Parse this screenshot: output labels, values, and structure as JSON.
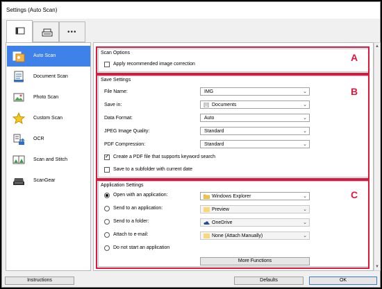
{
  "window": {
    "title": "Settings (Auto Scan)"
  },
  "top_tabs": [
    {
      "icon": "scan-from-computer-icon"
    },
    {
      "icon": "scan-from-operation-panel-icon"
    },
    {
      "icon": "more-icon",
      "label": "•••"
    }
  ],
  "sidebar": {
    "items": [
      {
        "label": "Auto Scan",
        "icon": "auto-scan-icon",
        "selected": true
      },
      {
        "label": "Document Scan",
        "icon": "document-scan-icon"
      },
      {
        "label": "Photo Scan",
        "icon": "photo-scan-icon"
      },
      {
        "label": "Custom Scan",
        "icon": "star-icon"
      },
      {
        "label": "OCR",
        "icon": "ocr-icon"
      },
      {
        "label": "Scan and Stitch",
        "icon": "stitch-icon"
      },
      {
        "label": "ScanGear",
        "icon": "scangear-icon"
      }
    ]
  },
  "scan_options": {
    "title": "Scan Options",
    "apply_correction_label": "Apply recommended image correction",
    "apply_correction_checked": false
  },
  "save_settings": {
    "title": "Save Settings",
    "file_name": {
      "label": "File Name:",
      "value": "IMG"
    },
    "save_in": {
      "label": "Save in:",
      "value": "Documents"
    },
    "data_format": {
      "label": "Data Format:",
      "value": "Auto"
    },
    "jpeg_quality": {
      "label": "JPEG Image Quality:",
      "value": "Standard"
    },
    "pdf_compression": {
      "label": "PDF Compression:",
      "value": "Standard"
    },
    "keyword_pdf_label": "Create a PDF file that supports keyword search",
    "keyword_pdf_checked": true,
    "subfolder_label": "Save to a subfolder with current date",
    "subfolder_checked": false
  },
  "application_settings": {
    "title": "Application Settings",
    "open_with_app": {
      "label": "Open with an application:",
      "value": "Windows Explorer",
      "selected": true
    },
    "send_to_app": {
      "label": "Send to an application:",
      "value": "Preview"
    },
    "send_to_folder": {
      "label": "Send to a folder:",
      "value": "OneDrive"
    },
    "attach_email": {
      "label": "Attach to e-mail:",
      "value": "None (Attach Manually)"
    },
    "do_not_start": {
      "label": "Do not start an application"
    },
    "more_functions_label": "More Functions"
  },
  "annotations": {
    "a": "A",
    "b": "B",
    "c": "C"
  },
  "bottom": {
    "instructions_label": "Instructions",
    "defaults_label": "Defaults",
    "ok_label": "OK"
  },
  "colors": {
    "highlight": "#e2163b",
    "selection": "#3e81e8"
  }
}
